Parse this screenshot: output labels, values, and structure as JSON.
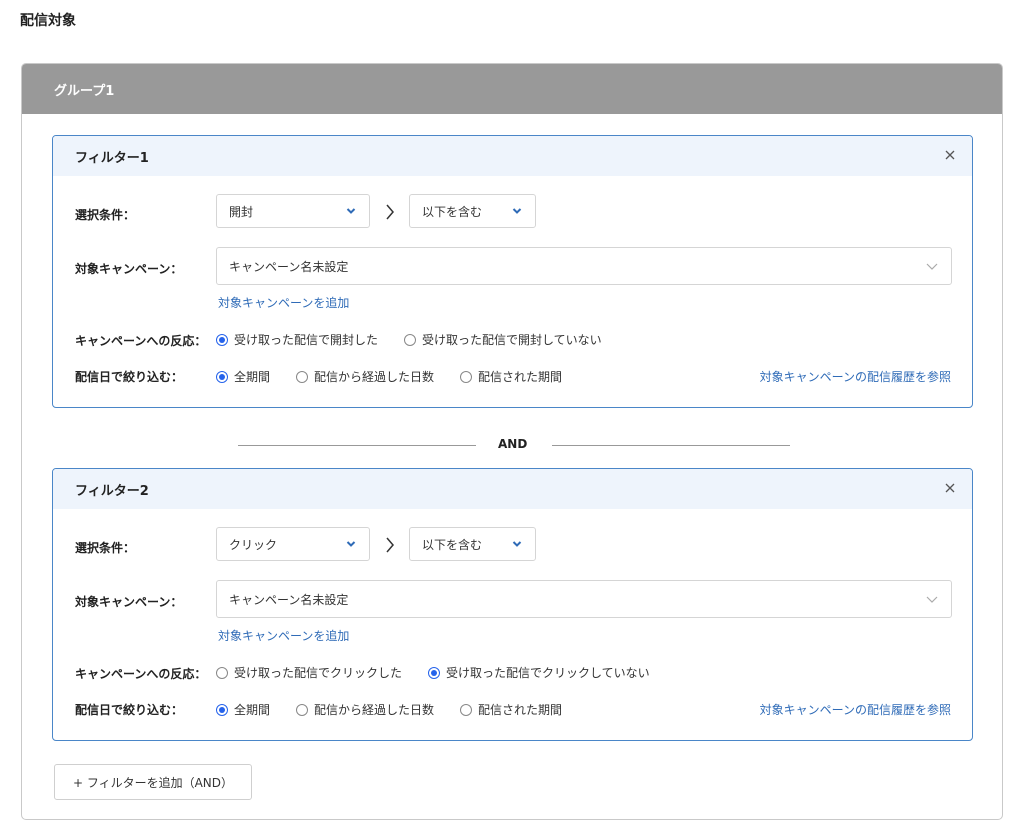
{
  "section_title": "配信対象",
  "group": {
    "title": "グループ1"
  },
  "labels": {
    "condition": "選択条件：",
    "campaign": "対象キャンペーン：",
    "reaction": "キャンペーンへの反応：",
    "date_filter": "配信日で絞り込む："
  },
  "filters": [
    {
      "title": "フィルター1",
      "condition_value": "開封",
      "operator_value": "以下を含む",
      "campaign_value": "キャンペーン名未設定",
      "add_campaign_link": "対象キャンペーンを追加",
      "reaction_options": [
        {
          "label": "受け取った配信で開封した",
          "checked": true
        },
        {
          "label": "受け取った配信で開封していない",
          "checked": false
        }
      ],
      "date_options": [
        {
          "label": "全期間",
          "checked": true
        },
        {
          "label": "配信から経過した日数",
          "checked": false
        },
        {
          "label": "配信された期間",
          "checked": false
        }
      ],
      "history_link": "対象キャンペーンの配信履歴を参照"
    },
    {
      "title": "フィルター2",
      "condition_value": "クリック",
      "operator_value": "以下を含む",
      "campaign_value": "キャンペーン名未設定",
      "add_campaign_link": "対象キャンペーンを追加",
      "reaction_options": [
        {
          "label": "受け取った配信でクリックした",
          "checked": false
        },
        {
          "label": "受け取った配信でクリックしていない",
          "checked": true
        }
      ],
      "date_options": [
        {
          "label": "全期間",
          "checked": true
        },
        {
          "label": "配信から経過した日数",
          "checked": false
        },
        {
          "label": "配信された期間",
          "checked": false
        }
      ],
      "history_link": "対象キャンペーンの配信履歴を参照"
    }
  ],
  "and_label": "AND",
  "add_filter_button": "+ フィルターを追加（AND）",
  "icons": {
    "close": "close-icon",
    "dropdown": "chevron-down-icon",
    "step": "chevron-right-icon"
  },
  "colors": {
    "group_header_bg": "#999999",
    "filter_border": "#4a86c8",
    "filter_header_bg": "#eef4fc",
    "link": "#2f6bb7",
    "radio_checked": "#2563eb"
  }
}
